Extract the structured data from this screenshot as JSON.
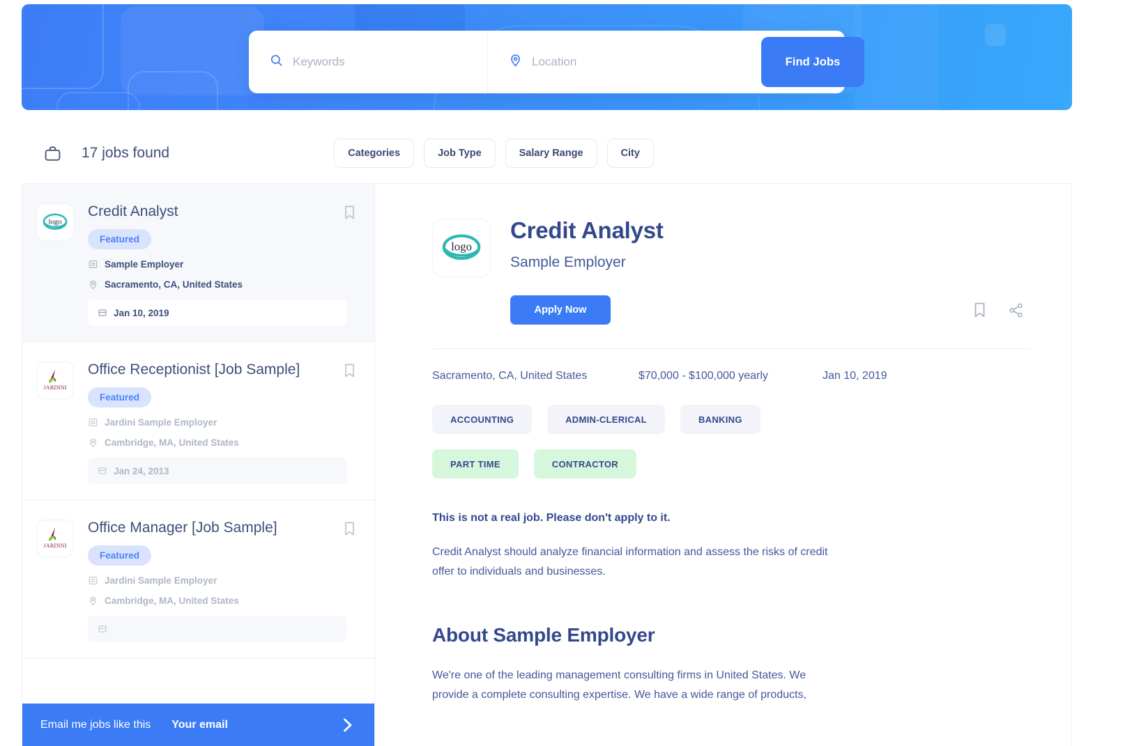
{
  "search": {
    "keywords_placeholder": "Keywords",
    "location_placeholder": "Location",
    "find_jobs_label": "Find Jobs"
  },
  "toolbar": {
    "jobs_found": "17 jobs found",
    "filters": [
      {
        "label": "Categories"
      },
      {
        "label": "Job Type"
      },
      {
        "label": "Salary Range"
      },
      {
        "label": "City"
      }
    ]
  },
  "joblist": {
    "cards": [
      {
        "title": "Credit Analyst",
        "badge": "Featured",
        "company": "Sample Employer",
        "location": "Sacramento, CA, United States",
        "date": "Jan 10, 2019",
        "logo": "logo-swoosh",
        "active": true
      },
      {
        "title": "Office Receptionist [Job Sample]",
        "badge": "Featured",
        "company": "Jardini Sample Employer",
        "location": "Cambridge, MA, United States",
        "date": "Jan 24, 2013",
        "logo": "jardini",
        "active": false
      },
      {
        "title": "Office Manager [Job Sample]",
        "badge": "Featured",
        "company": "Jardini Sample Employer",
        "location": "Cambridge, MA, United States",
        "date": "",
        "logo": "jardini",
        "active": false
      }
    ],
    "email_alert": {
      "label": "Email me jobs like this",
      "placeholder": "Your email",
      "value": ""
    }
  },
  "detail": {
    "title": "Credit Analyst",
    "company": "Sample Employer",
    "apply_label": "Apply Now",
    "location": "Sacramento, CA, United States",
    "salary": "$70,000 - $100,000 yearly",
    "date": "Jan 10, 2019",
    "categories": [
      "ACCOUNTING",
      "ADMIN-CLERICAL",
      "BANKING"
    ],
    "job_types": [
      "PART TIME",
      "CONTRACTOR"
    ],
    "notice": "This is not a real job. Please don't apply to it.",
    "description": "Credit Analyst should analyze financial information and assess the risks of credit offer to individuals and businesses.",
    "about_heading": "About Sample Employer",
    "about_body": "We're one of the leading management consulting firms in United States. We provide a complete consulting expertise. We have a wide range of products,"
  },
  "colors": {
    "accent_blue": "#3b7bf6",
    "title_navy": "#33488c",
    "body_navy": "#44589a",
    "badge_bg": "#d9e3fd",
    "tag_green": "#d7f7dd",
    "tag_grey": "#f2f4f9",
    "logo_teal": "#2cb7b4",
    "jardini_maroon": "#8c1f3f"
  }
}
